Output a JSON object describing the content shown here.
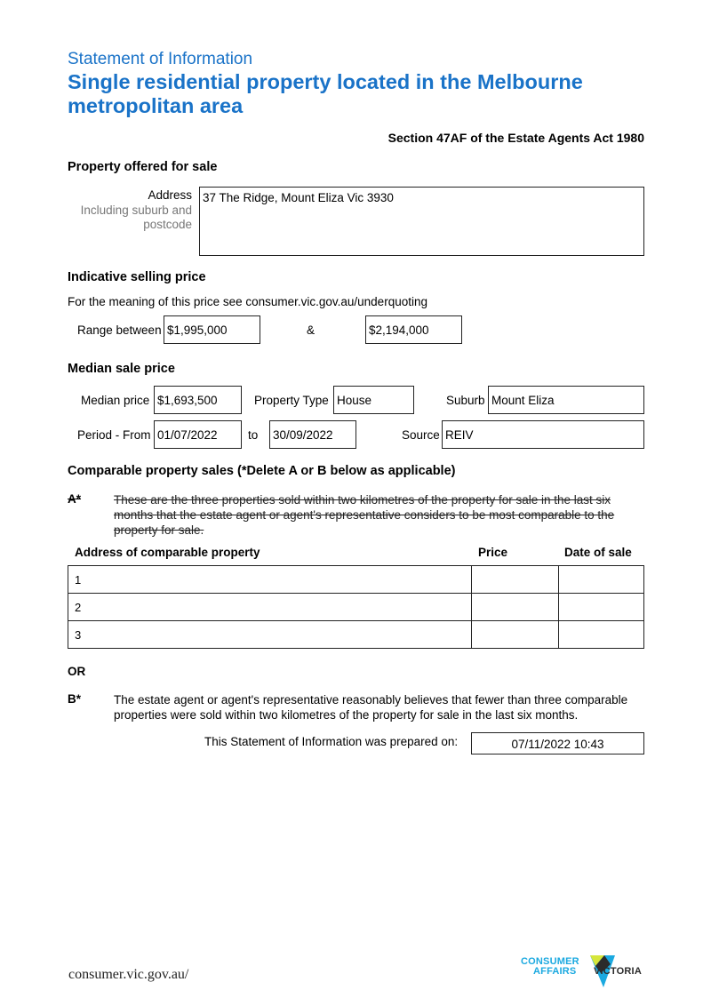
{
  "header": {
    "subtitle": "Statement of Information",
    "title": "Single residential property located in the Melbourne metropolitan area",
    "act": "Section 47AF of the Estate Agents Act 1980"
  },
  "property": {
    "heading": "Property offered for sale",
    "address_label": "Address",
    "address_hint": "Including suburb and postcode",
    "address_value": "37 The Ridge, Mount Eliza Vic 3930"
  },
  "indicative": {
    "heading": "Indicative selling price",
    "note": "For the meaning of this price see consumer.vic.gov.au/underquoting",
    "range_label": "Range between",
    "low": "$1,995,000",
    "amp": "&",
    "high": "$2,194,000"
  },
  "median": {
    "heading": "Median sale price",
    "median_label": "Median price",
    "median_value": "$1,693,500",
    "type_label": "Property Type",
    "type_value": "House",
    "suburb_label": "Suburb",
    "suburb_value": "Mount Eliza",
    "period_label": "Period - From",
    "from_value": "01/07/2022",
    "to_label": "to",
    "to_value": "30/09/2022",
    "source_label": "Source",
    "source_value": "REIV"
  },
  "comparable": {
    "heading": "Comparable property sales (*Delete A or B below as applicable)",
    "a_marker": "A*",
    "a_text": "These are the three properties sold within two kilometres of the property for sale in the last six months that the estate agent or agent's representative considers to be most comparable to the property for sale.",
    "columns": [
      "Address of comparable property",
      "Price",
      "Date of sale"
    ],
    "rows": [
      {
        "address": "1",
        "price": "",
        "date": ""
      },
      {
        "address": "2",
        "price": "",
        "date": ""
      },
      {
        "address": "3",
        "price": "",
        "date": ""
      }
    ],
    "or_label": "OR",
    "b_marker": "B*",
    "b_text": "The estate agent or agent's representative reasonably believes that fewer than three comparable properties were sold within two kilometres of the property for sale in the last six months."
  },
  "prepared": {
    "label": "This Statement of Information was prepared on:",
    "value": "07/11/2022 10:43"
  },
  "footer": {
    "url": "consumer.vic.gov.au/",
    "logo_line1": "CONSUMER",
    "logo_line2": "AFFAIRS",
    "logo_line3": "VICTORIA",
    "colors": {
      "cyan": "#1ba9e0",
      "lime": "#d6e63a",
      "dark": "#2b2b2b"
    }
  }
}
